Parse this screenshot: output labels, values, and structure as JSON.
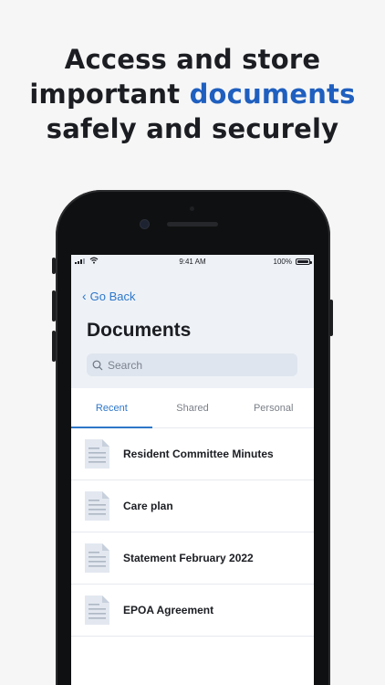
{
  "headline": {
    "line1": "Access and store",
    "line2_pre": "important ",
    "line2_accent": "documents",
    "line3": "safely and securely"
  },
  "status_bar": {
    "time": "9:41 AM",
    "battery": "100%"
  },
  "nav": {
    "back_label": "Go Back"
  },
  "page": {
    "title": "Documents"
  },
  "search": {
    "placeholder": "Search"
  },
  "tabs": [
    {
      "label": "Recent",
      "active": true
    },
    {
      "label": "Shared",
      "active": false
    },
    {
      "label": "Personal",
      "active": false
    }
  ],
  "documents": [
    {
      "name": "Resident Committee Minutes"
    },
    {
      "name": "Care plan"
    },
    {
      "name": "Statement February 2022"
    },
    {
      "name": "EPOA Agreement"
    }
  ],
  "colors": {
    "accent": "#2e77c9",
    "headline_accent": "#1f5fbf"
  }
}
